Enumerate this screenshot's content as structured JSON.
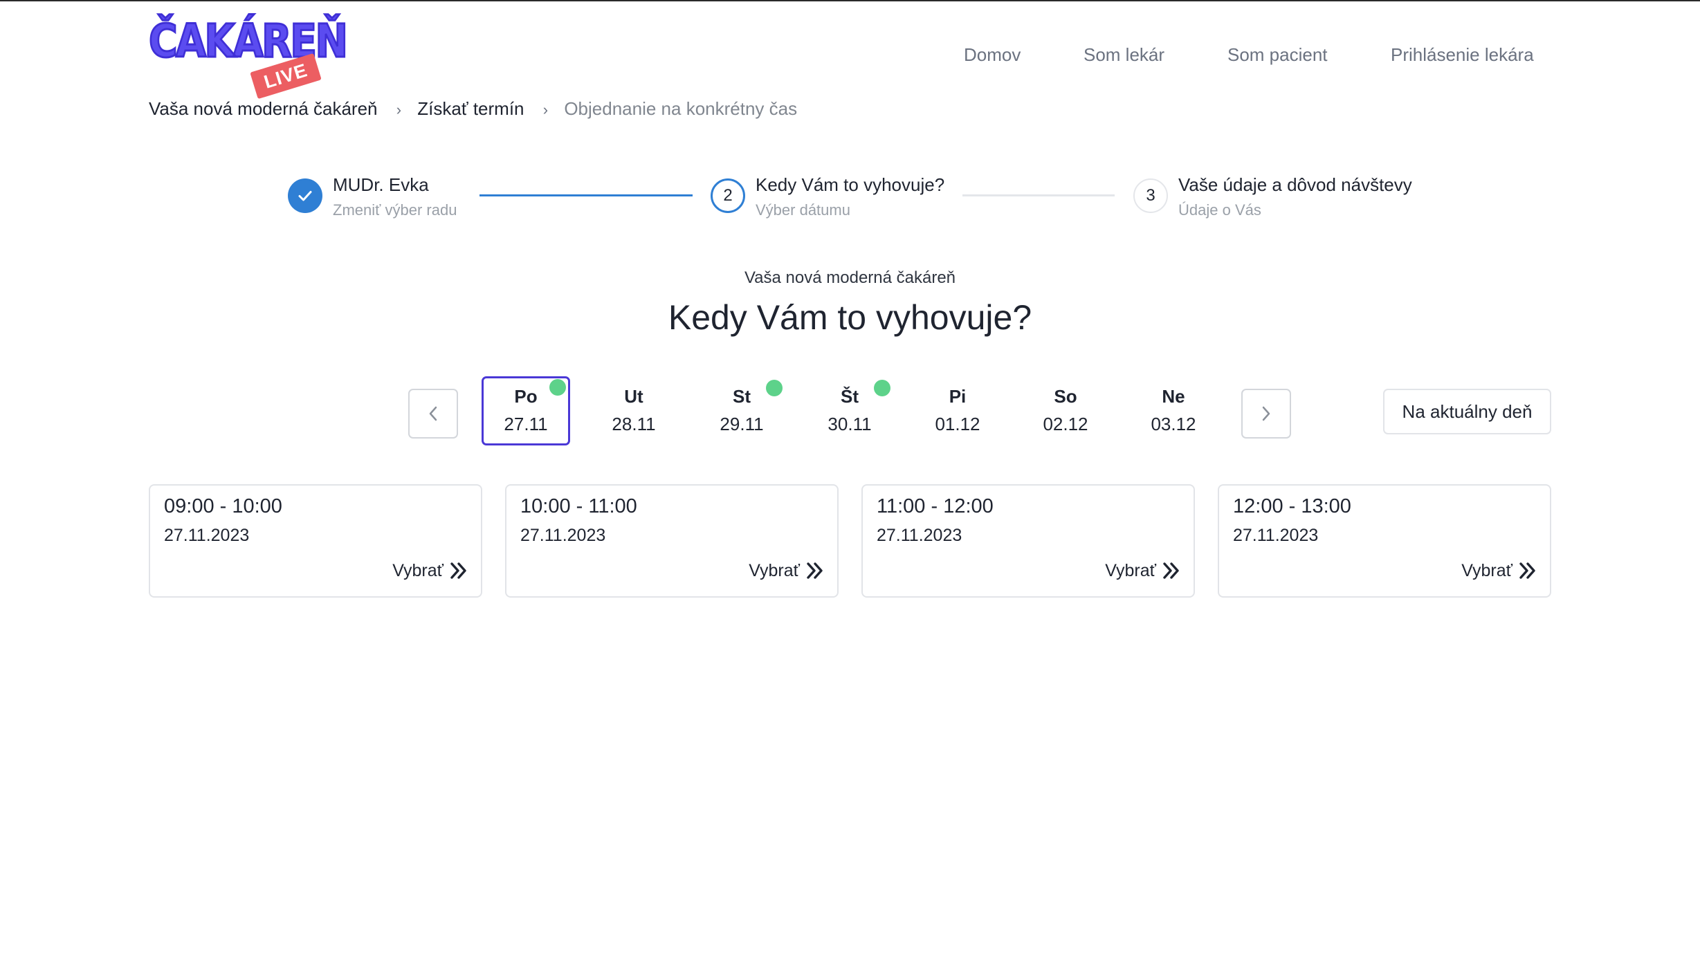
{
  "logo": {
    "text": "ČAKÁREŇ",
    "badge": "LIVE",
    "primary_color": "#5b4cf0",
    "badge_color": "#ec5e62"
  },
  "nav": {
    "items": [
      {
        "label": "Domov"
      },
      {
        "label": "Som lekár"
      },
      {
        "label": "Som pacient"
      },
      {
        "label": "Prihlásenie lekára"
      }
    ]
  },
  "breadcrumb": {
    "items": [
      {
        "label": "Vaša nová moderná čakáreň"
      },
      {
        "label": "Získať termín"
      },
      {
        "label": "Objednanie na konkrétny čas"
      }
    ],
    "separator": "›"
  },
  "stepper": {
    "steps": [
      {
        "title": "MUDr. Evka",
        "subtitle": "Zmeniť výber radu",
        "state": "done",
        "icon": "check-icon"
      },
      {
        "title": "Kedy Vám to vyhovuje?",
        "subtitle": "Výber dátumu",
        "state": "active",
        "number": "2"
      },
      {
        "title": "Vaše údaje a dôvod návštevy",
        "subtitle": "Údaje o Vás",
        "state": "todo",
        "number": "3"
      }
    ],
    "accent_color": "#2f7fd4"
  },
  "heading": {
    "subtitle": "Vaša nová moderná čakáreň",
    "title": "Kedy Vám to vyhovuje?"
  },
  "week": {
    "prev_icon": "chevron-left-icon",
    "next_icon": "chevron-right-icon",
    "days": [
      {
        "name": "Po",
        "date": "27.11",
        "selected": true,
        "available": true
      },
      {
        "name": "Ut",
        "date": "28.11",
        "selected": false,
        "available": false
      },
      {
        "name": "St",
        "date": "29.11",
        "selected": false,
        "available": true
      },
      {
        "name": "Št",
        "date": "30.11",
        "selected": false,
        "available": true
      },
      {
        "name": "Pi",
        "date": "01.12",
        "selected": false,
        "available": false
      },
      {
        "name": "So",
        "date": "02.12",
        "selected": false,
        "available": false
      },
      {
        "name": "Ne",
        "date": "03.12",
        "selected": false,
        "available": false
      }
    ],
    "today_label": "Na aktuálny deň",
    "available_color": "#5dd28a",
    "selected_color": "#4a38d6"
  },
  "slots": [
    {
      "time": "09:00 - 10:00",
      "date": "27.11.2023",
      "action": "Vybrať"
    },
    {
      "time": "10:00 - 11:00",
      "date": "27.11.2023",
      "action": "Vybrať"
    },
    {
      "time": "11:00 - 12:00",
      "date": "27.11.2023",
      "action": "Vybrať"
    },
    {
      "time": "12:00 - 13:00",
      "date": "27.11.2023",
      "action": "Vybrať"
    }
  ]
}
